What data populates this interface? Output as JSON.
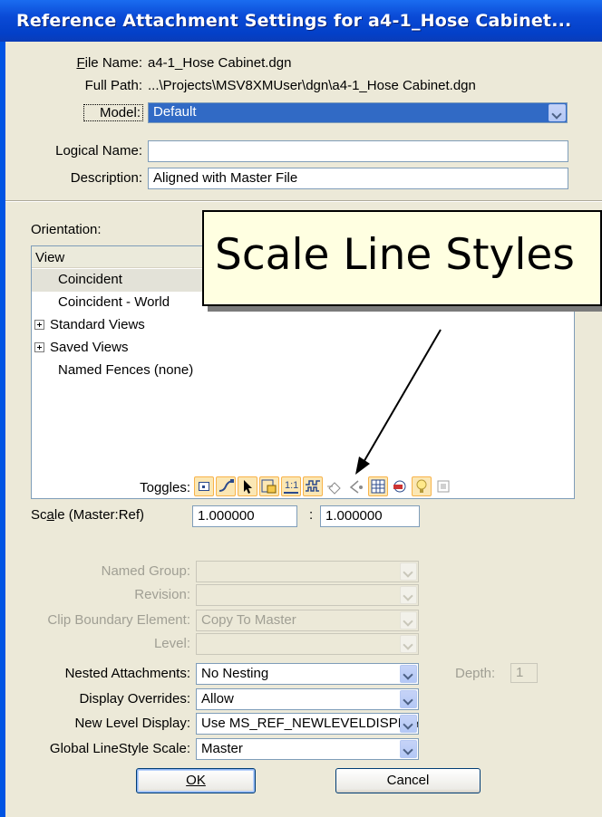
{
  "window": {
    "title": "Reference Attachment Settings for a4-1_Hose Cabinet..."
  },
  "file": {
    "file_name_label": "File Name:",
    "file_name_value": "a4-1_Hose Cabinet.dgn",
    "full_path_label": "Full Path:",
    "full_path_value": "...\\Projects\\MSV8XMUser\\dgn\\a4-1_Hose Cabinet.dgn",
    "model_label": "Model:",
    "model_value": "Default",
    "logical_name_label": "Logical Name:",
    "logical_name_value": "",
    "description_label": "Description:",
    "description_value": "Aligned with Master File"
  },
  "orientation": {
    "label": "Orientation:",
    "column_header": "View",
    "items": [
      {
        "label": "Coincident",
        "expandable": false,
        "selected": true
      },
      {
        "label": "Coincident - World",
        "expandable": false,
        "selected": false
      },
      {
        "label": "Standard Views",
        "expandable": true,
        "selected": false
      },
      {
        "label": "Saved Views",
        "expandable": true,
        "selected": false
      },
      {
        "label": "Named Fences (none)",
        "expandable": false,
        "selected": false
      }
    ]
  },
  "tooltip": {
    "text": "Scale Line Styles"
  },
  "toggles": {
    "label": "Toggles:",
    "icons": [
      {
        "name": "display-toggle-icon",
        "on": true,
        "glyph": ""
      },
      {
        "name": "snap-toggle-icon",
        "on": true,
        "glyph": ""
      },
      {
        "name": "locate-toggle-icon",
        "on": true,
        "glyph": ""
      },
      {
        "name": "ignore-attachment-toggle-icon",
        "on": true,
        "glyph": ""
      },
      {
        "name": "true-scale-toggle-icon",
        "on": true,
        "glyph": "1:1"
      },
      {
        "name": "scale-line-styles-toggle-icon",
        "on": true,
        "glyph": ""
      },
      {
        "name": "treat-as-element-toggle-icon",
        "on": false,
        "glyph": ""
      },
      {
        "name": "display-raster-refs-toggle-icon",
        "on": false,
        "glyph": ""
      },
      {
        "name": "use-lights-toggle-icon",
        "on": false,
        "glyph": ""
      },
      {
        "name": "level-display-toggle-icon",
        "on": false,
        "glyph": ""
      },
      {
        "name": "lightbulb-toggle-icon",
        "on": true,
        "glyph": ""
      },
      {
        "name": "print-toggle-icon",
        "on": false,
        "glyph": ""
      }
    ]
  },
  "scale": {
    "label": "Scale (Master:Ref)",
    "master": "1.000000",
    "separator": ":",
    "ref": "1.000000"
  },
  "settings": {
    "named_group_label": "Named Group:",
    "named_group_value": "",
    "revision_label": "Revision:",
    "revision_value": "",
    "clip_boundary_label": "Clip Boundary Element:",
    "clip_boundary_value": "Copy To Master",
    "level_label": "Level:",
    "level_value": "",
    "nested_label": "Nested Attachments:",
    "nested_value": "No Nesting",
    "depth_label": "Depth:",
    "depth_value": "1",
    "display_overrides_label": "Display Overrides:",
    "display_overrides_value": "Allow",
    "new_level_label": "New Level Display:",
    "new_level_value": "Use MS_REF_NEWLEVELDISPLAY",
    "global_ls_label": "Global LineStyle Scale:",
    "global_ls_value": "Master"
  },
  "buttons": {
    "ok": "OK",
    "cancel": "Cancel"
  },
  "colors": {
    "title_bar": "#0a4ad6",
    "dialog_bg": "#ece9d8",
    "selection": "#316ac5",
    "toggle_on": "#fbe7b4"
  }
}
